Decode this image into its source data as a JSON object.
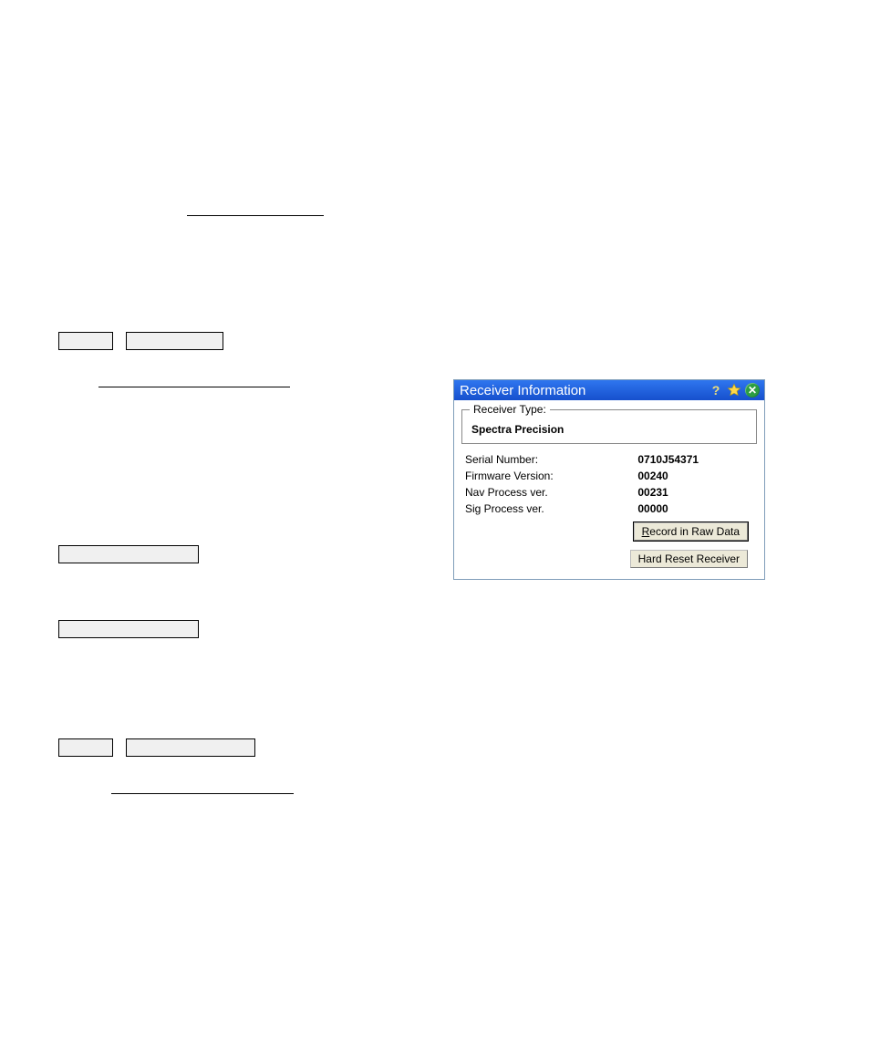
{
  "dialog": {
    "title": "Receiver Information",
    "group_label": "Receiver Type:",
    "group_value": "Spectra Precision",
    "rows": [
      {
        "label": "Serial Number:",
        "value": "0710J54371"
      },
      {
        "label": "Firmware Version:",
        "value": "00240"
      },
      {
        "label": "Nav Process ver.",
        "value": "00231"
      },
      {
        "label": "Sig Process ver.",
        "value": "00000"
      }
    ],
    "btn_record_prefix_mnemonic": "R",
    "btn_record_rest": "ecord in Raw Data",
    "btn_reset": "Hard Reset Receiver"
  }
}
